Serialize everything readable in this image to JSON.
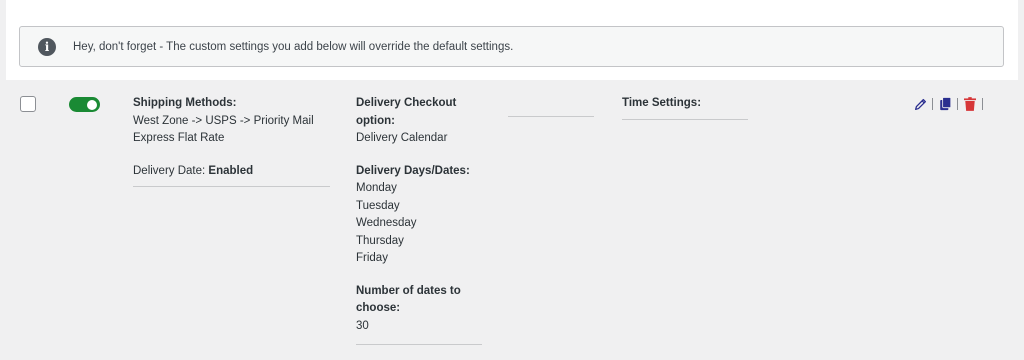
{
  "notice": {
    "icon": "info-icon",
    "text": "Hey, don't forget - The custom settings you add below will override the default settings."
  },
  "row": {
    "toggle_on": true,
    "toggle_color": "#1a8a34",
    "shipping": {
      "label": "Shipping Methods:",
      "lines": [
        "West Zone -> USPS -> Priority Mail",
        "Express Flat Rate"
      ],
      "delivery_date_label": "Delivery Date:",
      "delivery_date_value": "Enabled"
    },
    "checkout": {
      "label_line1": "Delivery Checkout",
      "label_line2": "option:",
      "value": "Delivery Calendar",
      "days_label": "Delivery Days/Dates:",
      "days": [
        "Monday",
        "Tuesday",
        "Wednesday",
        "Thursday",
        "Friday"
      ],
      "dates_label_line1": "Number of dates to",
      "dates_label_line2": "choose:",
      "dates_value": "30"
    },
    "time_settings": {
      "label": "Time Settings:"
    },
    "actions": {
      "edit_icon": "pencil-icon",
      "duplicate_icon": "copy-icon",
      "delete_icon": "trash-icon",
      "edit_color": "#2a2e8f",
      "duplicate_color": "#2a2e8f",
      "delete_color": "#d63638"
    }
  }
}
